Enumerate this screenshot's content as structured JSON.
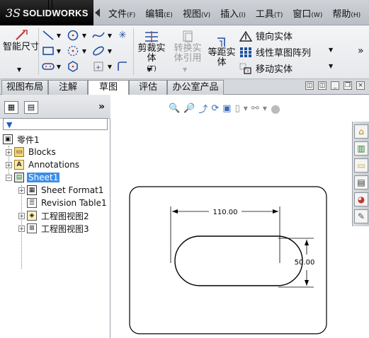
{
  "app": {
    "brand_symbol": "3S",
    "brand_name": "SOLIDWORKS"
  },
  "menubar": {
    "items": [
      {
        "label": "文件",
        "key": "(F)"
      },
      {
        "label": "编辑",
        "key": "(E)"
      },
      {
        "label": "视图",
        "key": "(V)"
      },
      {
        "label": "插入",
        "key": "(I)"
      },
      {
        "label": "工具",
        "key": "(T)"
      },
      {
        "label": "窗口",
        "key": "(W)"
      },
      {
        "label": "帮助",
        "key": "(H)"
      }
    ]
  },
  "ribbon": {
    "smart_dimension": "智能尺寸",
    "trim_entities": "剪裁实体",
    "trim_key": "(T)",
    "convert_entities": "转换实体引用",
    "offset_entities": "等距实体",
    "mirror_entities": "镜向实体",
    "linear_pattern": "线性草图阵列",
    "move_entities": "移动实体",
    "more": "»"
  },
  "tabs": {
    "items": [
      "视图布局",
      "注解",
      "草图",
      "评估",
      "办公室产品"
    ],
    "active_index": 2
  },
  "feature_tree": {
    "root": "零件1",
    "nodes": [
      {
        "label": "Blocks"
      },
      {
        "label": "Annotations"
      },
      {
        "label": "Sheet1"
      },
      {
        "label": "Sheet Format1"
      },
      {
        "label": "Revision Table1"
      },
      {
        "label": "工程图视图2"
      },
      {
        "label": "工程图视图3"
      }
    ],
    "selected": "Sheet1",
    "more": "»"
  },
  "drawing": {
    "dim_width": "110.00",
    "dim_height": "50.00"
  },
  "colors": {
    "selection": "#3d8ee6",
    "sketch_line": "#000000"
  }
}
